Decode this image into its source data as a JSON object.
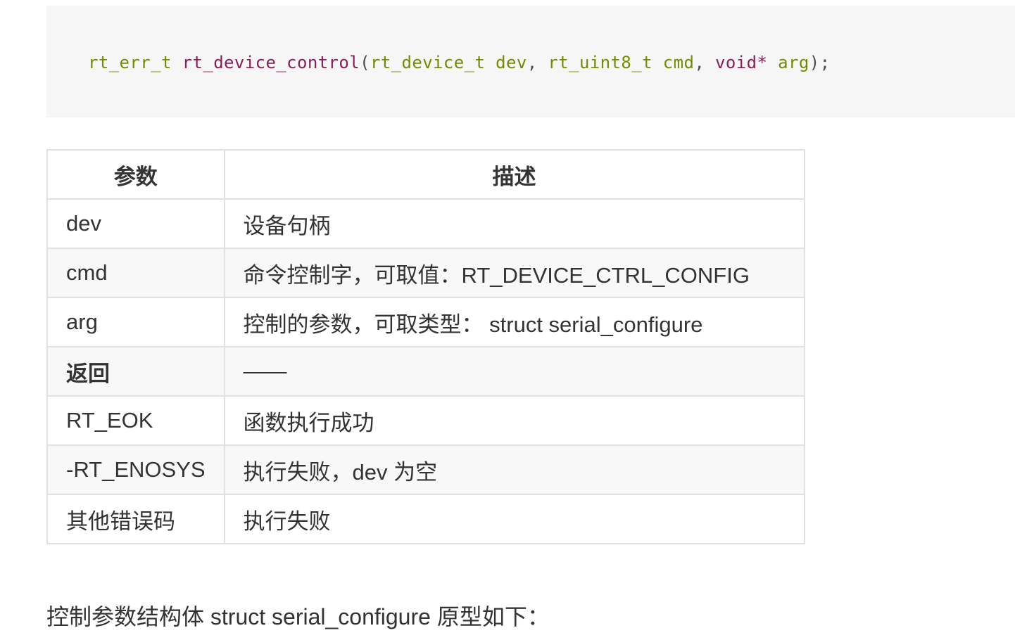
{
  "code": {
    "tokens": [
      {
        "text": "rt_err_t",
        "kind": "type"
      },
      {
        "text": " ",
        "kind": "punc"
      },
      {
        "text": "rt_device_control",
        "kind": "fn"
      },
      {
        "text": "(",
        "kind": "punc"
      },
      {
        "text": "rt_device_t",
        "kind": "type"
      },
      {
        "text": " ",
        "kind": "punc"
      },
      {
        "text": "dev",
        "kind": "type"
      },
      {
        "text": ", ",
        "kind": "punc"
      },
      {
        "text": "rt_uint8_t",
        "kind": "type"
      },
      {
        "text": " ",
        "kind": "punc"
      },
      {
        "text": "cmd",
        "kind": "type"
      },
      {
        "text": ", ",
        "kind": "punc"
      },
      {
        "text": "void*",
        "kind": "kw"
      },
      {
        "text": " ",
        "kind": "punc"
      },
      {
        "text": "arg",
        "kind": "type"
      },
      {
        "text": ");",
        "kind": "punc"
      }
    ]
  },
  "table": {
    "headers": [
      "参数",
      "描述"
    ],
    "rows": [
      {
        "param": "dev",
        "desc": "设备句柄",
        "bold": false
      },
      {
        "param": "cmd",
        "desc": "命令控制字，可取值：RT_DEVICE_CTRL_CONFIG",
        "bold": false
      },
      {
        "param": "arg",
        "desc": "控制的参数，可取类型： struct serial_configure",
        "bold": false
      },
      {
        "param": "返回",
        "desc": "——",
        "bold": true
      },
      {
        "param": "RT_EOK",
        "desc": "函数执行成功",
        "bold": false
      },
      {
        "param": "-RT_ENOSYS",
        "desc": "执行失败，dev 为空",
        "bold": false
      },
      {
        "param": "其他错误码",
        "desc": "执行失败",
        "bold": false
      }
    ]
  },
  "paragraph": {
    "text": "控制参数结构体 struct serial_configure 原型如下："
  },
  "colors": {
    "code_bg": "#f6f6f6",
    "type": "#718c00",
    "fn": "#8a1e59",
    "border": "#dfe2e5",
    "text": "#333333"
  }
}
